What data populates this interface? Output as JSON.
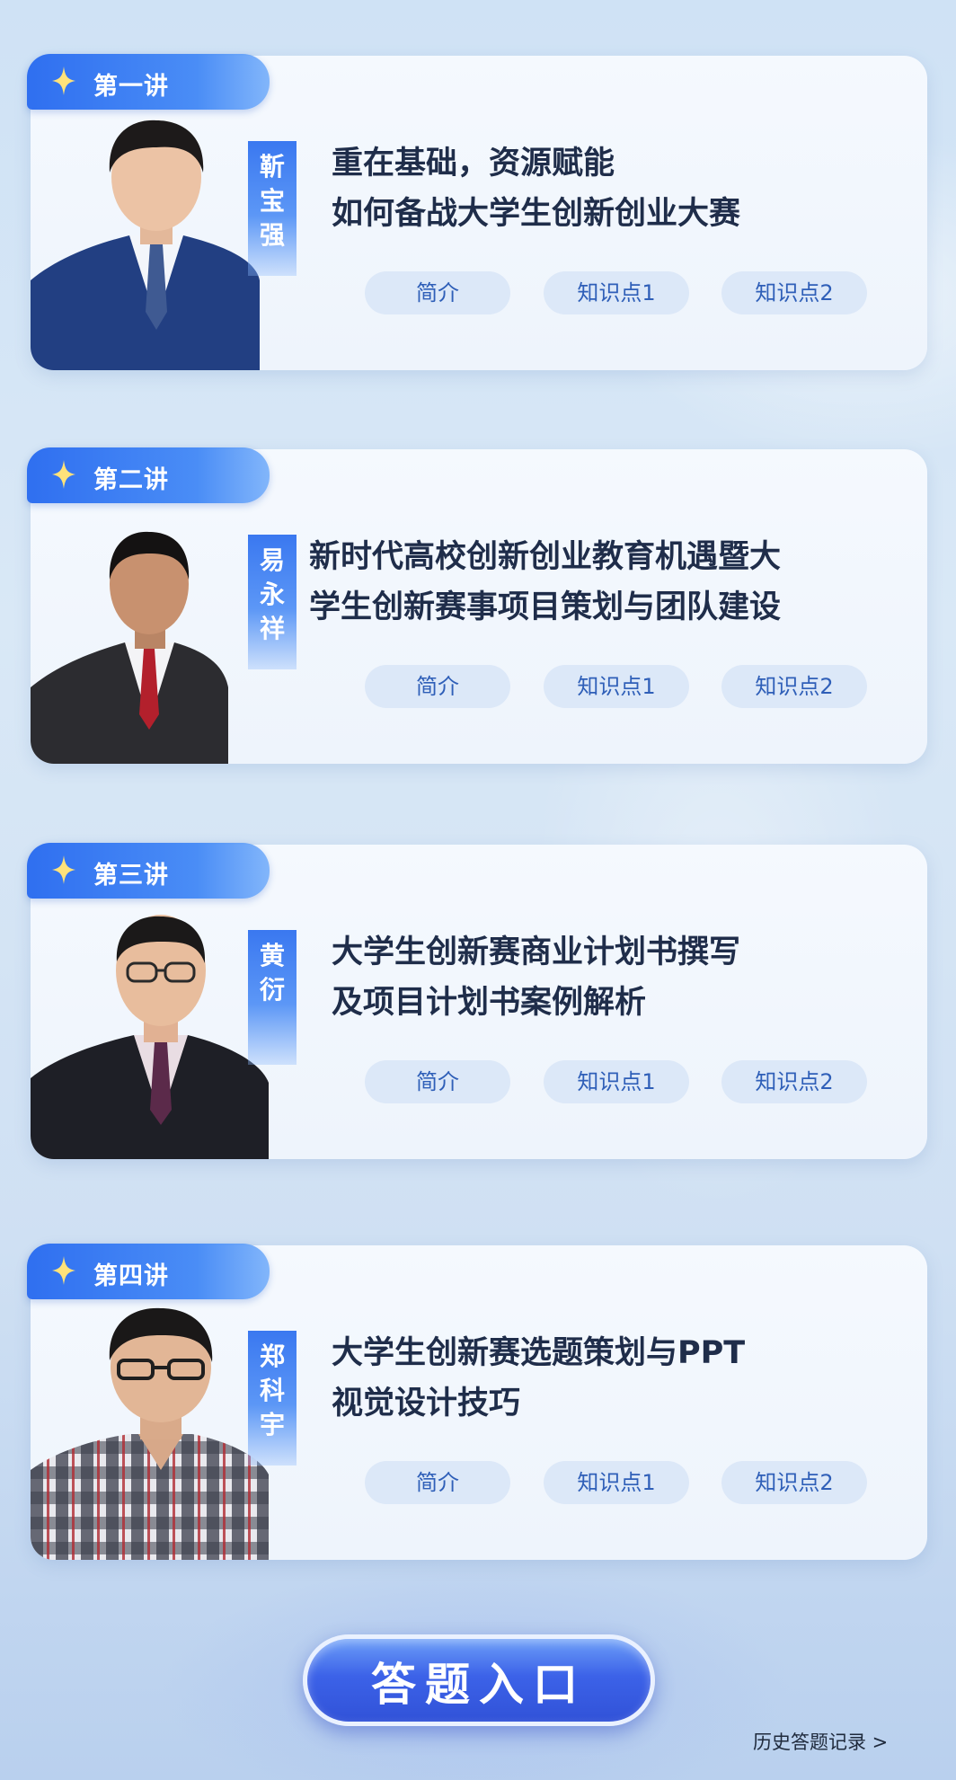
{
  "lectures": [
    {
      "badge": "第一讲",
      "speaker": [
        "靳",
        "宝",
        "强"
      ],
      "title_lines": [
        "重在基础，资源赋能",
        "如何备战大学生创新创业大赛"
      ],
      "buttons": [
        "简介",
        "知识点1",
        "知识点2"
      ]
    },
    {
      "badge": "第二讲",
      "speaker": [
        "易",
        "永",
        "祥"
      ],
      "title_lines": [
        "新时代高校创新创业教育机遇暨大",
        "学生创新赛事项目策划与团队建设"
      ],
      "buttons": [
        "简介",
        "知识点1",
        "知识点2"
      ]
    },
    {
      "badge": "第三讲",
      "speaker": [
        "黄",
        "衍"
      ],
      "title_lines": [
        "大学生创新赛商业计划书撰写",
        "及项目计划书案例解析"
      ],
      "buttons": [
        "简介",
        "知识点1",
        "知识点2"
      ]
    },
    {
      "badge": "第四讲",
      "speaker": [
        "郑",
        "科",
        "宇"
      ],
      "title_lines": [
        "大学生创新赛选题策划与PPT",
        "视觉设计技巧"
      ],
      "buttons": [
        "简介",
        "知识点1",
        "知识点2"
      ]
    }
  ],
  "entry_button": "答题入口",
  "history_link": "历史答题记录 >",
  "colors": {
    "accent": "#3a78f0",
    "title_text": "#1f2d4a",
    "pill_bg": "#dce8f8",
    "pill_text": "#2f5fb8"
  }
}
